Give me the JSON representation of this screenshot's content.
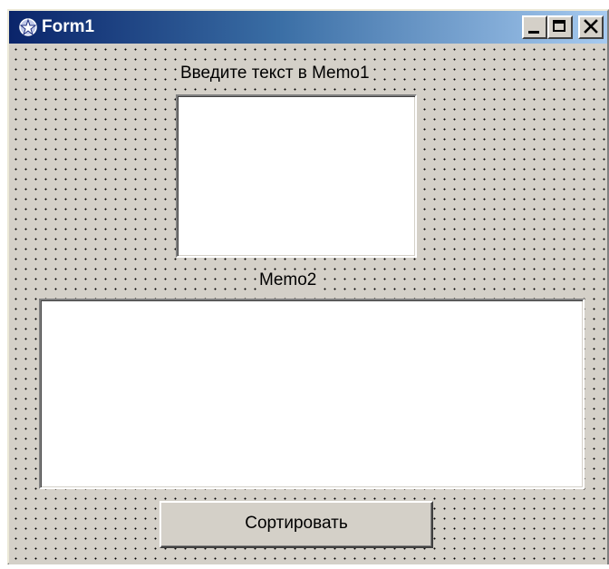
{
  "window": {
    "title": "Form1",
    "icon": "delphi-form-icon",
    "controls": {
      "minimize_icon": "minimize-icon",
      "maximize_icon": "maximize-icon",
      "close_icon": "close-icon"
    },
    "titlebar_colors": [
      "#0a246a",
      "#a6caf0"
    ],
    "client_color": "#d4d0c8"
  },
  "form": {
    "memo1_label": "Введите текст в Memo1",
    "memo1_value": "",
    "memo2_label": "Memo2",
    "memo2_value": "",
    "sort_button_label": "Сортировать"
  }
}
